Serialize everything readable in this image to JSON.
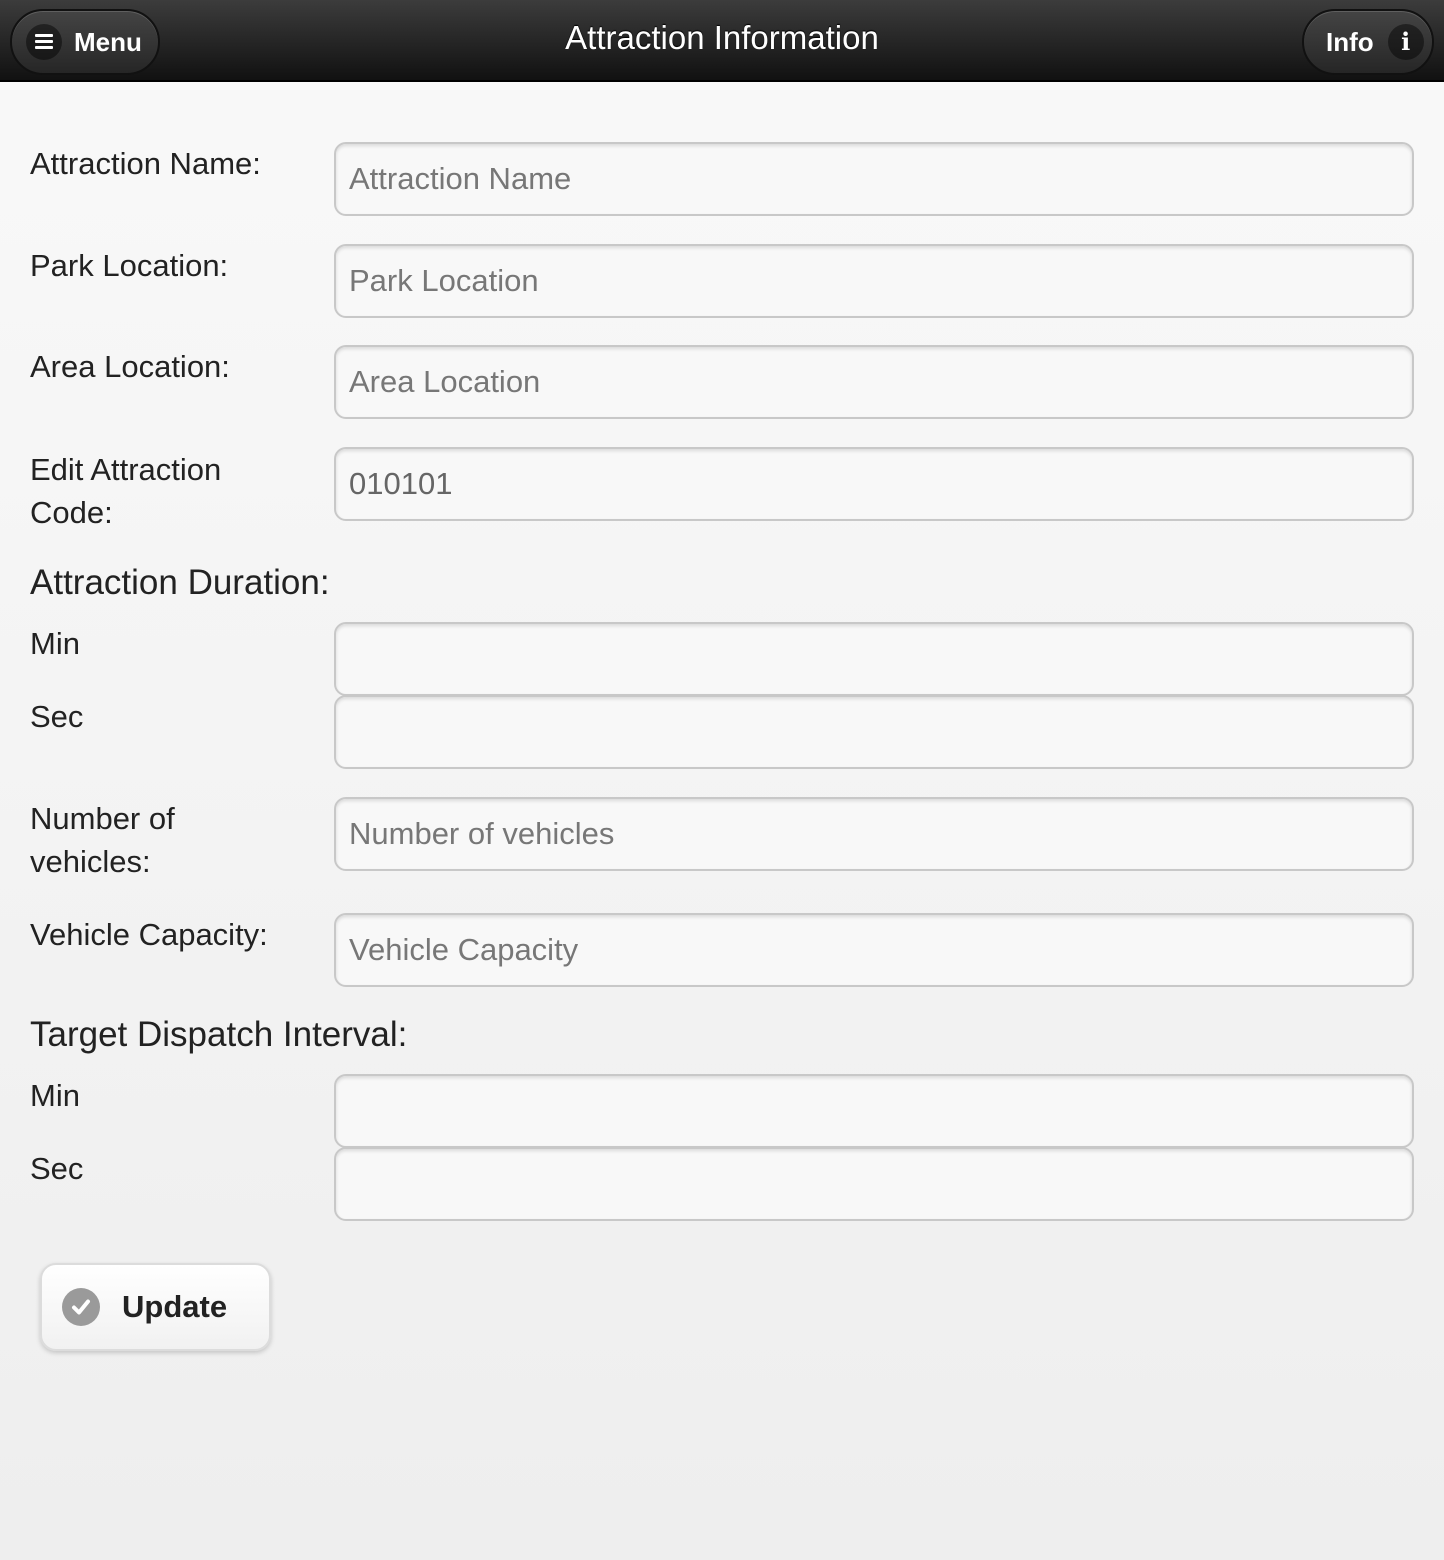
{
  "header": {
    "title": "Attraction Information",
    "menu_label": "Menu",
    "info_label": "Info"
  },
  "form": {
    "attraction_name": {
      "label": "Attraction Name:",
      "placeholder": "Attraction Name",
      "value": ""
    },
    "park_location": {
      "label": "Park Location:",
      "placeholder": "Park Location",
      "value": ""
    },
    "area_location": {
      "label": "Area Location:",
      "placeholder": "Area Location",
      "value": ""
    },
    "attraction_code": {
      "label": "Edit Attraction Code:",
      "placeholder": "",
      "value": "010101"
    },
    "duration": {
      "heading": "Attraction Duration:",
      "min_label": "Min",
      "sec_label": "Sec",
      "min_value": "",
      "sec_value": ""
    },
    "num_vehicles": {
      "label": "Number of vehicles:",
      "placeholder": "Number of vehicles",
      "value": ""
    },
    "vehicle_capacity": {
      "label": "Vehicle Capacity:",
      "placeholder": "Vehicle Capacity",
      "value": ""
    },
    "dispatch_interval": {
      "heading": "Target Dispatch Interval:",
      "min_label": "Min",
      "sec_label": "Sec",
      "min_value": "",
      "sec_value": ""
    },
    "update_label": "Update"
  },
  "icons": {
    "menu": "hamburger-icon",
    "info": "info-icon",
    "update": "check-icon"
  },
  "colors": {
    "header_bg": "#1e1e1e",
    "page_bg": "#f4f4f4",
    "field_border": "#c8c8c8"
  }
}
